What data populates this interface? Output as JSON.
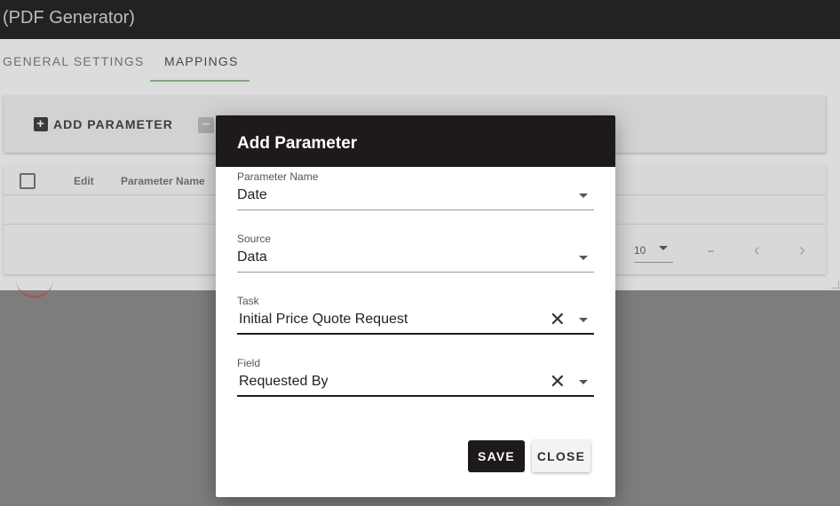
{
  "app": {
    "title": "(PDF Generator)"
  },
  "tabs": [
    {
      "label": "GENERAL SETTINGS",
      "active": false
    },
    {
      "label": "MAPPINGS",
      "active": true
    }
  ],
  "toolbar": {
    "add_parameter_label": "ADD PARAMETER",
    "add_icon": "plus-icon",
    "remove_icon": "minus-icon"
  },
  "table": {
    "headers": [
      "Edit",
      "Parameter Name"
    ],
    "rows_per_page": "10",
    "range_text": "–"
  },
  "dialog": {
    "title": "Add Parameter",
    "fields": [
      {
        "label": "Parameter Name",
        "value": "Date"
      },
      {
        "label": "Source",
        "value": "Data"
      },
      {
        "label": "Task",
        "value": "Initial Price Quote Request"
      },
      {
        "label": "Field",
        "value": "Requested By"
      }
    ],
    "save_label": "SAVE",
    "close_label": "CLOSE"
  },
  "colors": {
    "dialog_header": "#1f1a1a",
    "tab_underline": "#7fa97f"
  }
}
